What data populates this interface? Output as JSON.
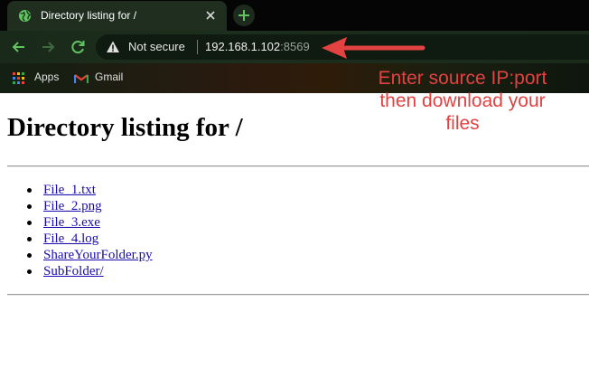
{
  "tab": {
    "title": "Directory listing for /",
    "favicon": "globe-icon"
  },
  "toolbar": {
    "security_label": "Not secure",
    "url_host": "192.168.1.102",
    "url_port": ":8569"
  },
  "bookmarks": [
    {
      "label": "Apps",
      "icon": "apps-grid-icon"
    },
    {
      "label": "Gmail",
      "icon": "gmail-icon"
    }
  ],
  "page": {
    "heading": "Directory listing for /",
    "files": [
      {
        "name": "File_1.txt"
      },
      {
        "name": "File_2.png"
      },
      {
        "name": "File_3.exe"
      },
      {
        "name": "File_4.log"
      },
      {
        "name": "ShareYourFolder.py"
      },
      {
        "name": "SubFolder/"
      }
    ]
  },
  "annotation": {
    "lines": [
      "Enter source IP:port",
      "then download your",
      "files"
    ],
    "color": "#e34242"
  },
  "colors": {
    "theme_green": "#1b2a1b",
    "link": "#1a0dab",
    "accent_green": "#5fc35f"
  }
}
